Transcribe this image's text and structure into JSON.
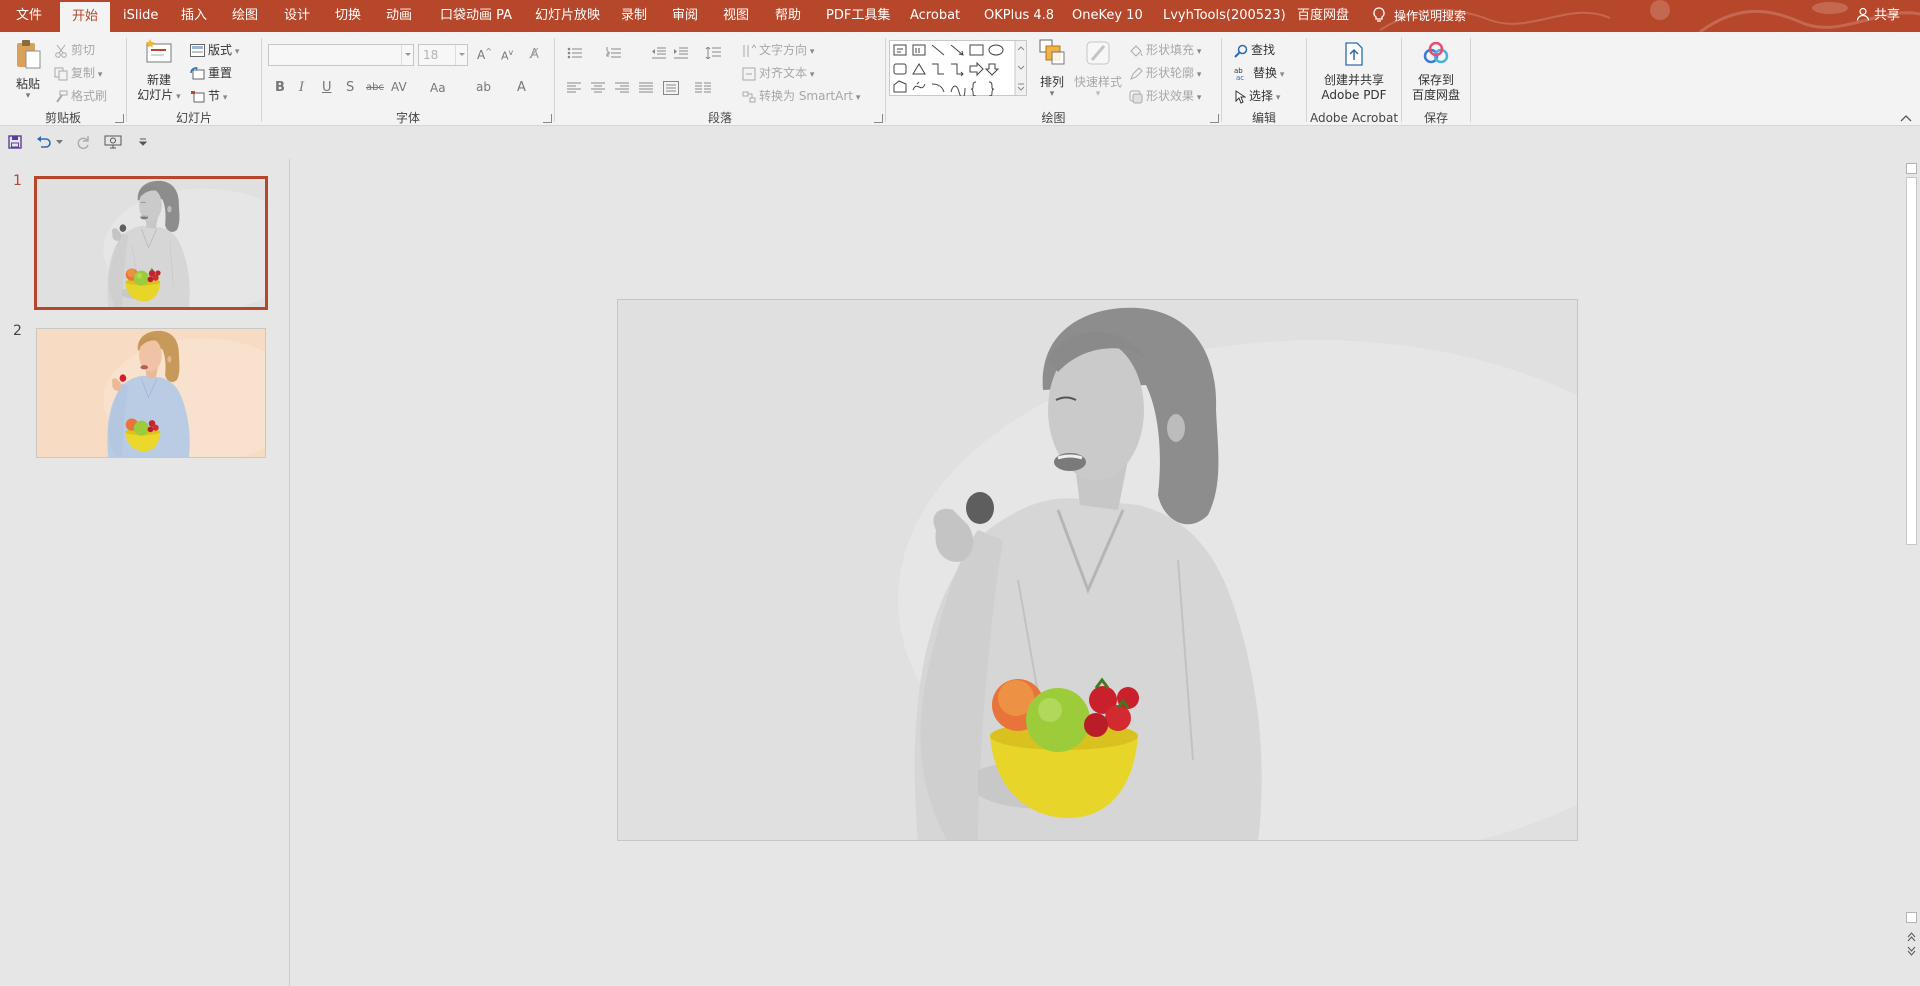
{
  "tabs": [
    {
      "label": "文件",
      "active": false
    },
    {
      "label": "开始",
      "active": true
    },
    {
      "label": "iSlide",
      "active": false
    },
    {
      "label": "插入",
      "active": false
    },
    {
      "label": "绘图",
      "active": false
    },
    {
      "label": "设计",
      "active": false
    },
    {
      "label": "切换",
      "active": false
    },
    {
      "label": "动画",
      "active": false
    },
    {
      "label": "口袋动画 PA",
      "active": false
    },
    {
      "label": "幻灯片放映",
      "active": false
    },
    {
      "label": "录制",
      "active": false
    },
    {
      "label": "审阅",
      "active": false
    },
    {
      "label": "视图",
      "active": false
    },
    {
      "label": "帮助",
      "active": false
    },
    {
      "label": "PDF工具集",
      "active": false
    },
    {
      "label": "Acrobat",
      "active": false
    },
    {
      "label": "OKPlus 4.8",
      "active": false
    },
    {
      "label": "OneKey 10",
      "active": false
    },
    {
      "label": "LvyhTools(200523)",
      "active": false
    },
    {
      "label": "百度网盘",
      "active": false
    }
  ],
  "tell_me": "操作说明搜索",
  "share": "共享",
  "ribbon": {
    "clipboard": {
      "label": "剪贴板",
      "paste": "粘贴",
      "cut": "剪切",
      "copy": "复制",
      "format_painter": "格式刷"
    },
    "slides": {
      "label": "幻灯片",
      "new_slide_l1": "新建",
      "new_slide_l2": "幻灯片",
      "layout": "版式",
      "reset": "重置",
      "section": "节"
    },
    "font": {
      "label": "字体",
      "font_name": "",
      "font_size": "18"
    },
    "paragraph": {
      "label": "段落",
      "text_direction": "文字方向",
      "align_text": "对齐文本",
      "smartart": "转换为 SmartArt"
    },
    "drawing": {
      "label": "绘图",
      "arrange": "排列",
      "quick_styles": "快速样式",
      "shape_fill": "形状填充",
      "shape_outline": "形状轮廓",
      "shape_effects": "形状效果"
    },
    "editing": {
      "label": "编辑",
      "find": "查找",
      "replace": "替换",
      "select": "选择"
    },
    "acrobat": {
      "label": "Adobe Acrobat",
      "create_l1": "创建并共享",
      "create_l2": "Adobe PDF"
    },
    "save": {
      "label": "保存",
      "save_l1": "保存到",
      "save_l2": "百度网盘"
    }
  },
  "slides": [
    {
      "number": "1",
      "selected": true,
      "style": "grayscale"
    },
    {
      "number": "2",
      "selected": false,
      "style": "color"
    }
  ],
  "colors": {
    "accent": "#b7472a",
    "ribbon_bg": "#f3f3f3",
    "workspace_bg": "#e6e6e6"
  }
}
